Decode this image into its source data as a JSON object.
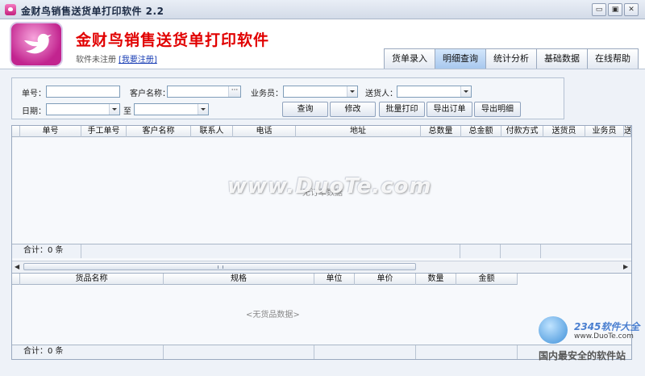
{
  "window": {
    "title": "金财鸟销售送货单打印软件 2.2",
    "min_glyph": "▭",
    "max_glyph": "▣",
    "close_glyph": "✕"
  },
  "header": {
    "app_title": "金财鸟销售送货单打印软件",
    "reg_status": "软件未注册",
    "reg_link": "[我要注册]",
    "logo_icon": "bird-icon"
  },
  "nav": {
    "tabs": [
      {
        "label": "货单录入"
      },
      {
        "label": "明细查询",
        "active": true
      },
      {
        "label": "统计分析"
      },
      {
        "label": "基础数据"
      },
      {
        "label": "在线帮助"
      }
    ]
  },
  "search": {
    "order_no_label": "单号：",
    "order_no_value": "",
    "customer_label": "客户名称：",
    "customer_value": "",
    "customer_btn": "···",
    "salesman_label": "业务员：",
    "salesman_value": "",
    "deliverer_label": "送货人：",
    "deliverer_value": "",
    "date_label": "日期：",
    "date_from": "",
    "to_label": "至",
    "date_to": "",
    "buttons": {
      "query": "查询",
      "edit": "修改",
      "batch_print": "批量打印",
      "export_orders": "导出订单",
      "export_details": "导出明细"
    }
  },
  "orders_grid": {
    "columns": [
      "单号",
      "手工单号",
      "客户名称",
      "联系人",
      "电话",
      "地址",
      "总数量",
      "总金额",
      "付款方式",
      "送货员",
      "业务员",
      "送"
    ],
    "empty_text": "无订单数据",
    "footer_total": "合计：0 条"
  },
  "items_grid": {
    "columns": [
      "货品名称",
      "规格",
      "单位",
      "单价",
      "数量",
      "金额"
    ],
    "empty_text": "<无货品数据>",
    "footer_total": "合计：0 条"
  },
  "scroll": {
    "left_glyph": "◀",
    "right_glyph": "▶"
  },
  "watermarks": {
    "main": "www.DuoTe.com",
    "corner_brand": "2345软件大全",
    "corner_url": "www.DuoTe.com",
    "corner_slogan": "国内最安全的软件站"
  }
}
